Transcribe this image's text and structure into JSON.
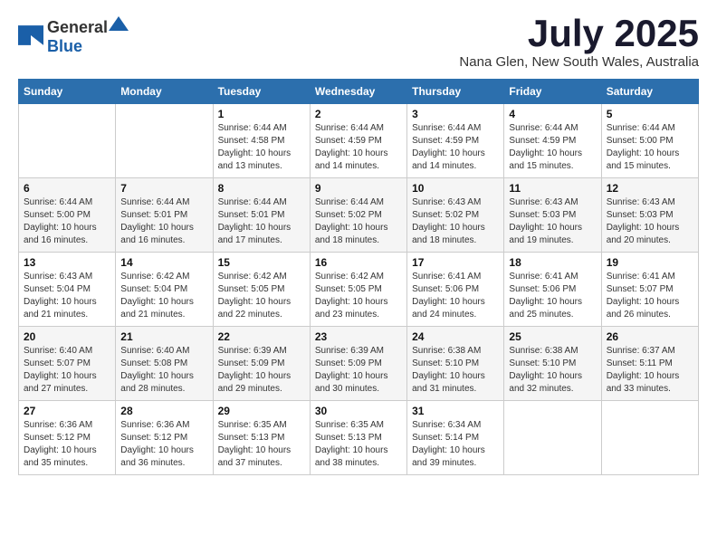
{
  "logo": {
    "general": "General",
    "blue": "Blue"
  },
  "title": {
    "month": "July 2025",
    "location": "Nana Glen, New South Wales, Australia"
  },
  "calendar": {
    "headers": [
      "Sunday",
      "Monday",
      "Tuesday",
      "Wednesday",
      "Thursday",
      "Friday",
      "Saturday"
    ],
    "weeks": [
      [
        {
          "day": "",
          "detail": ""
        },
        {
          "day": "",
          "detail": ""
        },
        {
          "day": "1",
          "detail": "Sunrise: 6:44 AM\nSunset: 4:58 PM\nDaylight: 10 hours and 13 minutes."
        },
        {
          "day": "2",
          "detail": "Sunrise: 6:44 AM\nSunset: 4:59 PM\nDaylight: 10 hours and 14 minutes."
        },
        {
          "day": "3",
          "detail": "Sunrise: 6:44 AM\nSunset: 4:59 PM\nDaylight: 10 hours and 14 minutes."
        },
        {
          "day": "4",
          "detail": "Sunrise: 6:44 AM\nSunset: 4:59 PM\nDaylight: 10 hours and 15 minutes."
        },
        {
          "day": "5",
          "detail": "Sunrise: 6:44 AM\nSunset: 5:00 PM\nDaylight: 10 hours and 15 minutes."
        }
      ],
      [
        {
          "day": "6",
          "detail": "Sunrise: 6:44 AM\nSunset: 5:00 PM\nDaylight: 10 hours and 16 minutes."
        },
        {
          "day": "7",
          "detail": "Sunrise: 6:44 AM\nSunset: 5:01 PM\nDaylight: 10 hours and 16 minutes."
        },
        {
          "day": "8",
          "detail": "Sunrise: 6:44 AM\nSunset: 5:01 PM\nDaylight: 10 hours and 17 minutes."
        },
        {
          "day": "9",
          "detail": "Sunrise: 6:44 AM\nSunset: 5:02 PM\nDaylight: 10 hours and 18 minutes."
        },
        {
          "day": "10",
          "detail": "Sunrise: 6:43 AM\nSunset: 5:02 PM\nDaylight: 10 hours and 18 minutes."
        },
        {
          "day": "11",
          "detail": "Sunrise: 6:43 AM\nSunset: 5:03 PM\nDaylight: 10 hours and 19 minutes."
        },
        {
          "day": "12",
          "detail": "Sunrise: 6:43 AM\nSunset: 5:03 PM\nDaylight: 10 hours and 20 minutes."
        }
      ],
      [
        {
          "day": "13",
          "detail": "Sunrise: 6:43 AM\nSunset: 5:04 PM\nDaylight: 10 hours and 21 minutes."
        },
        {
          "day": "14",
          "detail": "Sunrise: 6:42 AM\nSunset: 5:04 PM\nDaylight: 10 hours and 21 minutes."
        },
        {
          "day": "15",
          "detail": "Sunrise: 6:42 AM\nSunset: 5:05 PM\nDaylight: 10 hours and 22 minutes."
        },
        {
          "day": "16",
          "detail": "Sunrise: 6:42 AM\nSunset: 5:05 PM\nDaylight: 10 hours and 23 minutes."
        },
        {
          "day": "17",
          "detail": "Sunrise: 6:41 AM\nSunset: 5:06 PM\nDaylight: 10 hours and 24 minutes."
        },
        {
          "day": "18",
          "detail": "Sunrise: 6:41 AM\nSunset: 5:06 PM\nDaylight: 10 hours and 25 minutes."
        },
        {
          "day": "19",
          "detail": "Sunrise: 6:41 AM\nSunset: 5:07 PM\nDaylight: 10 hours and 26 minutes."
        }
      ],
      [
        {
          "day": "20",
          "detail": "Sunrise: 6:40 AM\nSunset: 5:07 PM\nDaylight: 10 hours and 27 minutes."
        },
        {
          "day": "21",
          "detail": "Sunrise: 6:40 AM\nSunset: 5:08 PM\nDaylight: 10 hours and 28 minutes."
        },
        {
          "day": "22",
          "detail": "Sunrise: 6:39 AM\nSunset: 5:09 PM\nDaylight: 10 hours and 29 minutes."
        },
        {
          "day": "23",
          "detail": "Sunrise: 6:39 AM\nSunset: 5:09 PM\nDaylight: 10 hours and 30 minutes."
        },
        {
          "day": "24",
          "detail": "Sunrise: 6:38 AM\nSunset: 5:10 PM\nDaylight: 10 hours and 31 minutes."
        },
        {
          "day": "25",
          "detail": "Sunrise: 6:38 AM\nSunset: 5:10 PM\nDaylight: 10 hours and 32 minutes."
        },
        {
          "day": "26",
          "detail": "Sunrise: 6:37 AM\nSunset: 5:11 PM\nDaylight: 10 hours and 33 minutes."
        }
      ],
      [
        {
          "day": "27",
          "detail": "Sunrise: 6:36 AM\nSunset: 5:12 PM\nDaylight: 10 hours and 35 minutes."
        },
        {
          "day": "28",
          "detail": "Sunrise: 6:36 AM\nSunset: 5:12 PM\nDaylight: 10 hours and 36 minutes."
        },
        {
          "day": "29",
          "detail": "Sunrise: 6:35 AM\nSunset: 5:13 PM\nDaylight: 10 hours and 37 minutes."
        },
        {
          "day": "30",
          "detail": "Sunrise: 6:35 AM\nSunset: 5:13 PM\nDaylight: 10 hours and 38 minutes."
        },
        {
          "day": "31",
          "detail": "Sunrise: 6:34 AM\nSunset: 5:14 PM\nDaylight: 10 hours and 39 minutes."
        },
        {
          "day": "",
          "detail": ""
        },
        {
          "day": "",
          "detail": ""
        }
      ]
    ]
  }
}
